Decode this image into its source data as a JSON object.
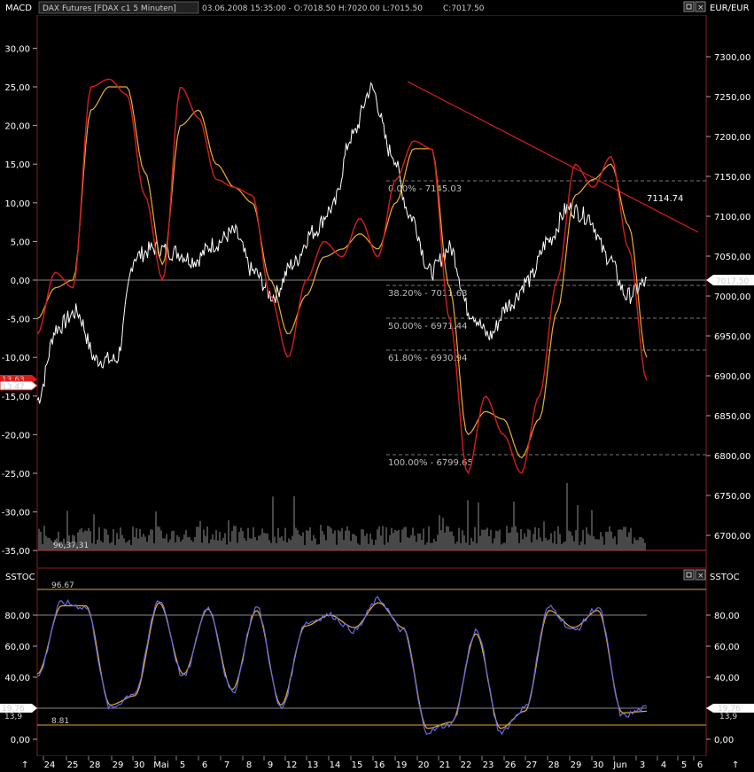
{
  "top_pane": {
    "indicator_label": "MACD",
    "instrument_label": "DAX Futures [FDAX c1  5 Minuten]",
    "ohlc_text": "03.06.2008 15:35:00 - O:7018.50 H:7020.00 L:7015.50",
    "close_text": "C:7017.50",
    "currency_label": "EUR/EUR",
    "price_tag": "7017,50",
    "macd_tag_a": "13,63",
    "macd_tag_b": "13,47",
    "volume_label": "96,37,31",
    "trendline_value": "7114.74",
    "fib_levels": [
      {
        "label": "0.00% - 7145.03"
      },
      {
        "label": "38.20% - 7011.63"
      },
      {
        "label": "50.00% - 6971.44"
      },
      {
        "label": "61.80% - 6930.94"
      },
      {
        "label": "100.00% - 6799.65"
      }
    ]
  },
  "bottom_pane": {
    "indicator_label": "SSTOC",
    "indicator_label_right": "SSTOC",
    "upper_level": "96.67",
    "lower_level": "8.81",
    "tag_a": "19,76",
    "tag_b": "13,9",
    "tag_right_a": "19,76",
    "tag_right_b": "13,9"
  },
  "x_axis": {
    "labels": [
      "24",
      "25",
      "28",
      "29",
      "30",
      "Mai",
      "5",
      "6",
      "7",
      "8",
      "9",
      "12",
      "13",
      "14",
      "15",
      "16",
      "19",
      "20",
      "21",
      "22",
      "23",
      "26",
      "27",
      "28",
      "29",
      "30",
      "Jun",
      "3",
      "4",
      "5",
      "6"
    ]
  },
  "colors": {
    "macd_red": "#d81c1c",
    "signal_yellow": "#e8b030",
    "price_white": "#ffffff",
    "stoch_blue": "#6a6ae8",
    "stoch_yellow": "#e8b030",
    "level_line": "#d8a640",
    "pane_border": "#c03030"
  },
  "chart_data": [
    {
      "type": "line",
      "title": "MACD",
      "y_left_ticks": [
        "30,00",
        "25,00",
        "20,00",
        "15,00",
        "10,00",
        "5,00",
        "0,00",
        "-5,00",
        "-10,00",
        "-15,00",
        "-20,00",
        "-25,00",
        "-30,00",
        "-35,00"
      ],
      "y_right_ticks": [
        "7300,00",
        "7250,00",
        "7200,00",
        "7150,00",
        "7100,00",
        "7050,00",
        "7000,00",
        "6950,00",
        "6900,00",
        "6850,00",
        "6800,00",
        "6750,00",
        "6700,00"
      ],
      "ylim_left": [
        -35,
        30
      ],
      "ylim_right": [
        6680,
        7310
      ],
      "series": [
        {
          "name": "MACD",
          "values": [
            -7,
            1,
            -1,
            25,
            26,
            24,
            11,
            0,
            25,
            21,
            13,
            12,
            11,
            -2,
            -10,
            0,
            5,
            3,
            8,
            3,
            13,
            18,
            17,
            -5,
            -25,
            -15,
            -20,
            -25,
            -15,
            0,
            15,
            12,
            16,
            4,
            -13
          ]
        },
        {
          "name": "Signal",
          "values": [
            -5,
            -1,
            0,
            22,
            25,
            25,
            14,
            2,
            20,
            22,
            15,
            12,
            10,
            0,
            -7,
            -2,
            3,
            4,
            6,
            4,
            10,
            17,
            17,
            -1,
            -20,
            -17,
            -18,
            -23,
            -18,
            -4,
            11,
            13,
            15,
            7,
            -10
          ]
        }
      ],
      "price_series": [
        6870,
        6960,
        6980,
        6920,
        6920,
        7050,
        7060,
        7055,
        7045,
        7065,
        7080,
        7030,
        7000,
        7040,
        7080,
        7110,
        7200,
        7260,
        7180,
        7100,
        7030,
        7060,
        6980,
        6950,
        6990,
        7020,
        7070,
        7110,
        7100,
        7050,
        7000,
        7017
      ]
    },
    {
      "type": "line",
      "title": "SSTOC",
      "y_ticks": [
        "80,00",
        "60,00",
        "40,00",
        "20,00",
        "0,00"
      ],
      "ylim": [
        -5,
        105
      ],
      "reference_lines": [
        96.67,
        80,
        20,
        8.81
      ],
      "series": [
        {
          "name": "%K",
          "values": [
            40,
            88,
            85,
            20,
            30,
            90,
            40,
            85,
            30,
            85,
            20,
            75,
            80,
            70,
            90,
            70,
            5,
            10,
            70,
            5,
            20,
            85,
            70,
            85,
            15,
            20
          ]
        },
        {
          "name": "%D",
          "values": [
            42,
            86,
            86,
            22,
            28,
            88,
            42,
            84,
            32,
            83,
            22,
            73,
            80,
            72,
            88,
            72,
            7,
            11,
            68,
            7,
            18,
            83,
            72,
            83,
            17,
            18
          ]
        }
      ]
    }
  ]
}
